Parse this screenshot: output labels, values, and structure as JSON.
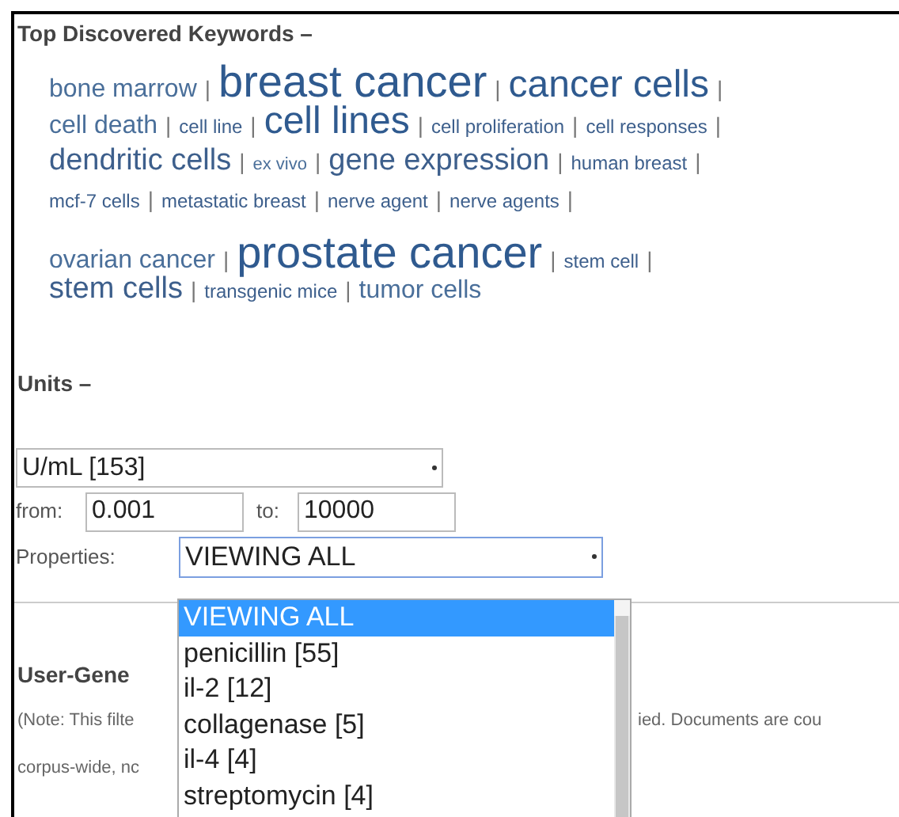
{
  "keywords": {
    "title": "Top Discovered Keywords –",
    "lines": [
      [
        {
          "text": "bone marrow",
          "kind": "m",
          "separator": "|"
        },
        {
          "text": "breast cancer",
          "kind": "xl",
          "separator": "|"
        },
        {
          "text": "cancer cells",
          "kind": "l",
          "separator": "|"
        }
      ],
      [
        {
          "text": "cell death",
          "kind": "m",
          "separator": "|"
        },
        {
          "text": "cell line",
          "kind": "s",
          "separator": "|"
        },
        {
          "text": "cell lines",
          "kind": "l",
          "separator": "|"
        },
        {
          "text": "cell proliferation",
          "kind": "s",
          "separator": "|"
        },
        {
          "text": "cell responses",
          "kind": "s",
          "separator": "|"
        }
      ],
      [
        {
          "text": "dendritic cells",
          "kind": "ml",
          "separator": "|"
        },
        {
          "text": "ex vivo",
          "kind": "xs",
          "separator": "|"
        },
        {
          "text": "gene expression",
          "kind": "ml",
          "separator": "|"
        },
        {
          "text": "human breast",
          "kind": "s",
          "separator": "|"
        }
      ],
      [
        {
          "text": "mcf-7 cells",
          "kind": "s",
          "separator": "|"
        },
        {
          "text": "metastatic breast",
          "kind": "s",
          "separator": "|"
        },
        {
          "text": "nerve agent",
          "kind": "s",
          "separator": "|"
        },
        {
          "text": "nerve agents",
          "kind": "s",
          "separator": "|"
        }
      ],
      [
        {
          "text": "ovarian cancer",
          "kind": "m",
          "separator": "|"
        },
        {
          "text": "prostate cancer",
          "kind": "xl",
          "separator": "|"
        },
        {
          "text": "stem cell",
          "kind": "s",
          "separator": "|"
        }
      ],
      [
        {
          "text": "stem cells",
          "kind": "ml",
          "separator": "|"
        },
        {
          "text": "transgenic mice",
          "kind": "s",
          "separator": "|"
        },
        {
          "text": "tumor cells",
          "kind": "m"
        }
      ]
    ]
  },
  "units": {
    "title": "Units –",
    "unit_select": {
      "value": "U/mL [153]"
    },
    "from_label": "from:",
    "from_value": "0.001",
    "to_label": "to:",
    "to_value": "10000",
    "properties_label": "Properties:",
    "properties_select": {
      "value": "VIEWING ALL"
    },
    "properties_options": [
      {
        "label": "VIEWING ALL",
        "selected": true
      },
      {
        "label": "penicillin [55]",
        "selected": false
      },
      {
        "label": "il-2 [12]",
        "selected": false
      },
      {
        "label": "collagenase [5]",
        "selected": false
      },
      {
        "label": "il-4 [4]",
        "selected": false
      },
      {
        "label": "streptomycin [4]",
        "selected": false
      }
    ]
  },
  "user_generated": {
    "title": "User-Gene",
    "note_line_1_left": "(Note: This filte",
    "note_line_1_right": "ied. Documents are cou",
    "note_line_2_left": "corpus-wide, nc"
  }
}
